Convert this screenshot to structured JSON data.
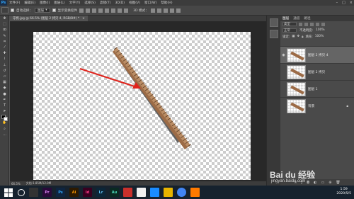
{
  "menu": {
    "logo": "Ps",
    "items": [
      "文件(F)",
      "编辑(E)",
      "图像(I)",
      "图层(L)",
      "文字(Y)",
      "选择(S)",
      "滤镜(T)",
      "3D(D)",
      "视图(V)",
      "窗口(W)",
      "帮助(H)"
    ],
    "window_controls": [
      "–",
      "□",
      "×"
    ]
  },
  "options": {
    "auto_select_label": "自动选择：",
    "auto_select_value": "图层",
    "show_transform_label": "显示变换控件",
    "mode_3d_label": "3D 模式："
  },
  "document": {
    "tab_label": "牙梳.jpg @ 66.5% (图层 2 拷贝 4, RGB/8#) *",
    "tab_close": "×"
  },
  "status": {
    "zoom": "66.5%",
    "doc_info": "文档:1.85M/12.0M"
  },
  "layers_panel": {
    "tabs": [
      "图层",
      "通道",
      "路径"
    ],
    "filter_label": "类型",
    "blend_mode": "正常",
    "opacity_label": "不透明度:",
    "opacity_value": "100%",
    "lock_label": "锁定:",
    "fill_label": "填充:",
    "fill_value": "100%",
    "layers": [
      {
        "name": "图层 2 拷贝 4",
        "selected": true,
        "has_lock": false
      },
      {
        "name": "图层 2 拷贝",
        "selected": false,
        "has_lock": false
      },
      {
        "name": "图层 1",
        "selected": false,
        "has_lock": false
      },
      {
        "name": "背景",
        "selected": false,
        "has_lock": true
      }
    ]
  },
  "watermark": {
    "brand": "Bai du 经验",
    "url": "jingyan.baidu.com"
  },
  "taskbar": {
    "apps": [
      {
        "name": "Pr",
        "bg": "#2a0a3a",
        "fg": "#e48aff"
      },
      {
        "name": "Ps",
        "bg": "#0f2540",
        "fg": "#31a8ff"
      },
      {
        "name": "Ai",
        "bg": "#2e1a00",
        "fg": "#ff9a00"
      },
      {
        "name": "Id",
        "bg": "#3a0020",
        "fg": "#ff3d8b"
      },
      {
        "name": "Lr",
        "bg": "#0c2638",
        "fg": "#66c8ff"
      },
      {
        "name": "Au",
        "bg": "#0a2a22",
        "fg": "#4fe3c1"
      }
    ],
    "time": "1:59",
    "date": "2020/5/5"
  },
  "colors": {
    "arrow": "#e0231c",
    "comb": "#9c6b46",
    "comb_shadow": "#4a4a4a"
  }
}
